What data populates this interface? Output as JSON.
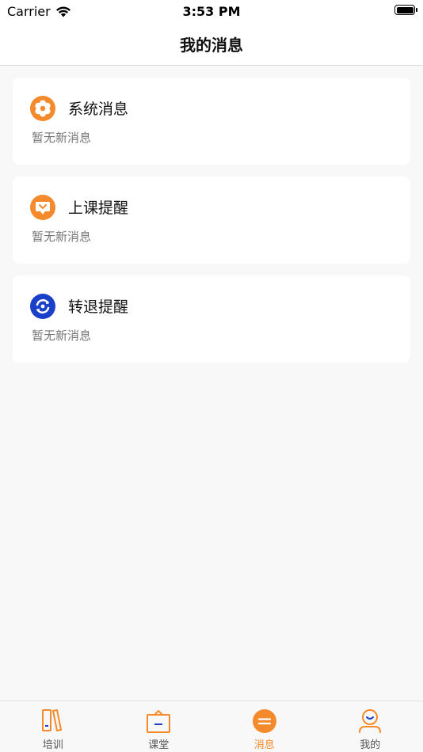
{
  "status_bar": {
    "carrier": "Carrier",
    "time": "3:53 PM",
    "wifi_icon": "wifi-icon",
    "battery_icon": "battery-icon"
  },
  "nav": {
    "title": "我的消息"
  },
  "messages": [
    {
      "icon": "gear-icon",
      "title": "系统消息",
      "subtitle": "暂无新消息"
    },
    {
      "icon": "chat-icon",
      "title": "上课提醒",
      "subtitle": "暂无新消息"
    },
    {
      "icon": "transfer-icon",
      "title": "转退提醒",
      "subtitle": "暂无新消息"
    }
  ],
  "tabs": [
    {
      "icon": "book-icon",
      "label": "培训",
      "active": false
    },
    {
      "icon": "classroom-icon",
      "label": "课堂",
      "active": false
    },
    {
      "icon": "message-icon",
      "label": "消息",
      "active": true
    },
    {
      "icon": "profile-icon",
      "label": "我的",
      "active": false
    }
  ],
  "colors": {
    "accent": "#f58a2c",
    "blue": "#1a3fc9",
    "background": "#f8f8f8"
  }
}
